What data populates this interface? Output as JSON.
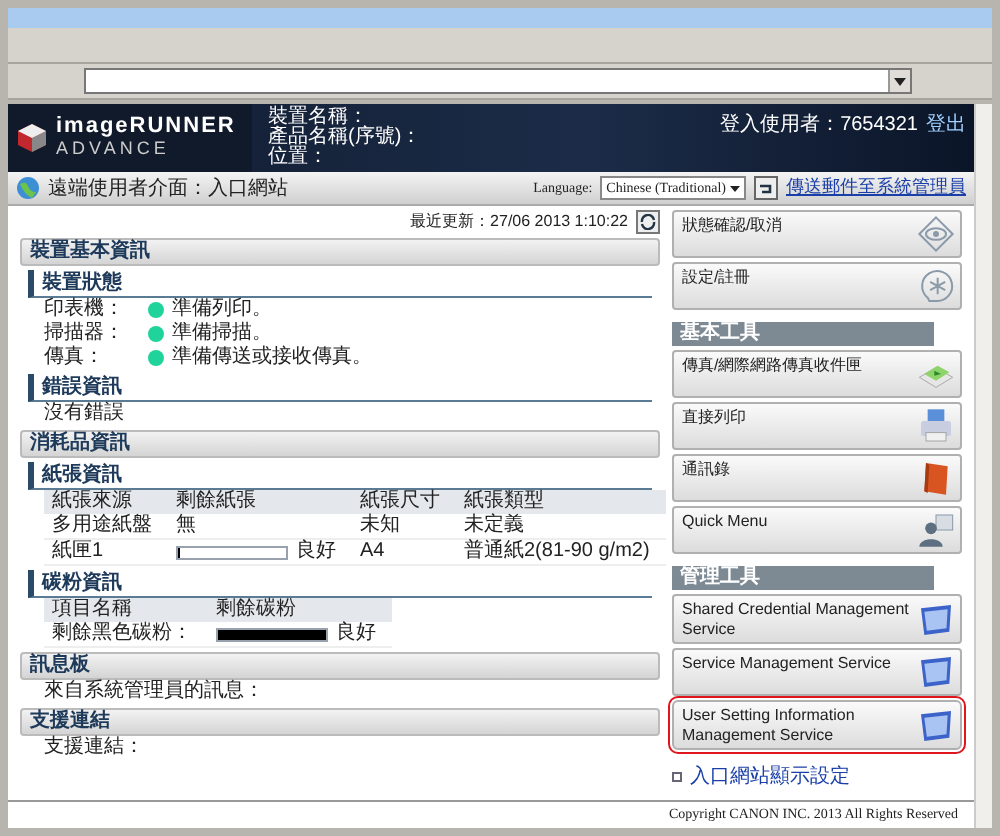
{
  "header": {
    "logo_line1": "imageRUNNER",
    "logo_line2": "ADVANCE",
    "device_fields": [
      "裝置名稱：",
      "產品名稱(序號)：",
      "位置："
    ],
    "user_label": "登入使用者：7654321",
    "logout": "登出"
  },
  "subheader": {
    "title": "遠端使用者介面：入口網站",
    "language_label": "Language:",
    "language_value": "Chinese (Traditional)",
    "mail_link": "傳送郵件至系統管理員"
  },
  "last_updated": "最近更新：27/06 2013 1:10:22",
  "sections": [
    {
      "title": "裝置基本資訊",
      "blocks": [
        {
          "kind": "status",
          "title": "裝置狀態",
          "rows": [
            {
              "label": "印表機：",
              "text": "準備列印。",
              "color": "#1fd39a"
            },
            {
              "label": "掃描器：",
              "text": "準備掃描。",
              "color": "#1fd39a"
            },
            {
              "label": "傳真：",
              "text": "準備傳送或接收傳真。",
              "color": "#1fd39a"
            }
          ]
        },
        {
          "kind": "text",
          "title": "錯誤資訊",
          "lines": [
            "沒有錯誤"
          ]
        }
      ]
    },
    {
      "title": "消耗品資訊",
      "blocks": [
        {
          "kind": "table",
          "title": "紙張資訊",
          "columns": [
            "紙張來源",
            "剩餘紙張",
            "紙張尺寸",
            "紙張類型"
          ],
          "rows": [
            {
              "cells": [
                {
                  "kind": "text",
                  "text": "多用途紙盤"
                },
                {
                  "kind": "text",
                  "text": "無"
                },
                {
                  "kind": "text",
                  "text": "未知"
                },
                {
                  "kind": "text",
                  "text": "未定義"
                }
              ]
            },
            {
              "cells": [
                {
                  "kind": "text",
                  "text": "紙匣1"
                },
                {
                  "kind": "meter",
                  "level": 0,
                  "text": "良好"
                },
                {
                  "kind": "text",
                  "text": "A4"
                },
                {
                  "kind": "text",
                  "text": "普通紙2(81-90 g/m2)"
                }
              ]
            }
          ]
        },
        {
          "kind": "table",
          "title": "碳粉資訊",
          "columns": [
            "項目名稱",
            "剩餘碳粉"
          ],
          "rows": [
            {
              "cells": [
                {
                  "kind": "text",
                  "text": "剩餘黑色碳粉："
                },
                {
                  "kind": "meter",
                  "level": 1,
                  "text": "良好"
                }
              ]
            }
          ]
        }
      ]
    },
    {
      "title": "訊息板",
      "blocks": [
        {
          "kind": "text",
          "lines": [
            "來自系統管理員的訊息："
          ]
        }
      ]
    },
    {
      "title": "支援連結",
      "blocks": [
        {
          "kind": "text",
          "lines": [
            "支援連結："
          ]
        }
      ]
    }
  ],
  "side_panel": [
    {
      "kind": "button",
      "label": "狀態確認/取消",
      "highlighted": false
    },
    {
      "kind": "button",
      "label": "設定/註冊",
      "highlighted": false
    },
    {
      "kind": "heading",
      "label": "基本工具"
    },
    {
      "kind": "button",
      "label": "傳真/網際網路傳真收件匣",
      "highlighted": false
    },
    {
      "kind": "button",
      "label": "直接列印",
      "highlighted": false
    },
    {
      "kind": "button",
      "label": "通訊錄",
      "highlighted": false
    },
    {
      "kind": "button",
      "label": "Quick Menu",
      "highlighted": false
    },
    {
      "kind": "heading",
      "label": "管理工具"
    },
    {
      "kind": "button",
      "label": "Shared Credential Management Service",
      "highlighted": false
    },
    {
      "kind": "button",
      "label": "Service Management Service",
      "highlighted": false
    },
    {
      "kind": "button",
      "label": "User Setting Information Management Service",
      "highlighted": true
    }
  ],
  "portal_link": "入口網站顯示設定",
  "copyright": "Copyright CANON INC. 2013 All Rights Reserved"
}
